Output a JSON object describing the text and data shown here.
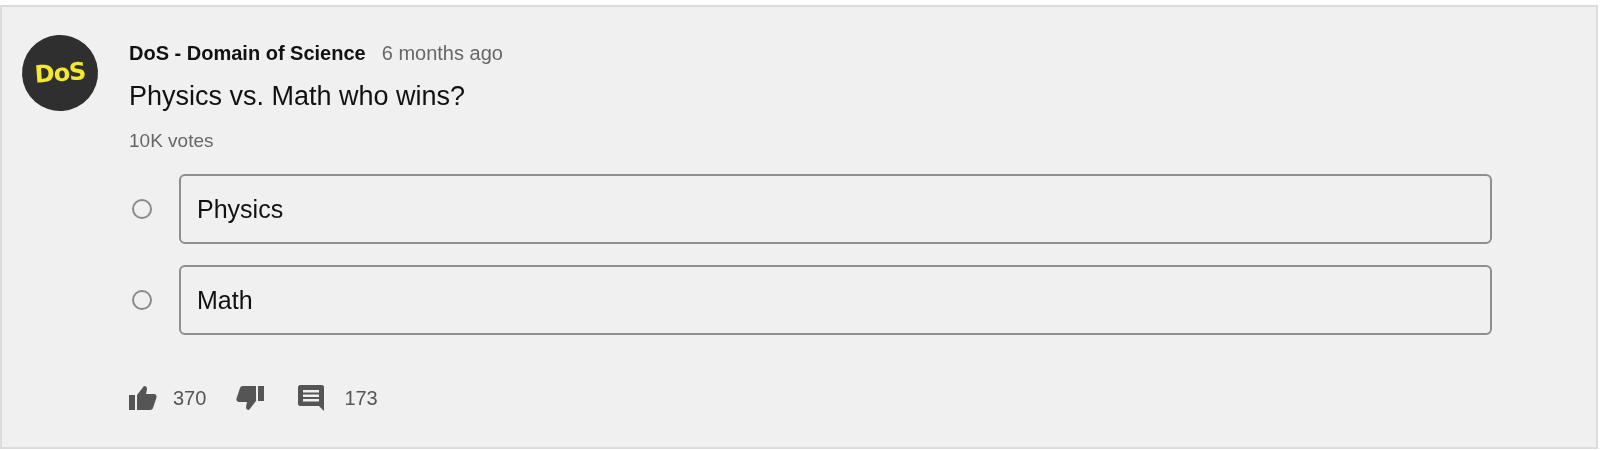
{
  "post": {
    "avatar_text": "DoS",
    "author": "DoS - Domain of Science",
    "time": "6 months ago",
    "question": "Physics vs. Math who wins?",
    "votes": "10K votes",
    "options": [
      {
        "label": "Physics",
        "selected": false
      },
      {
        "label": "Math",
        "selected": false
      }
    ],
    "actions": {
      "likes": "370",
      "comments": "173"
    }
  }
}
